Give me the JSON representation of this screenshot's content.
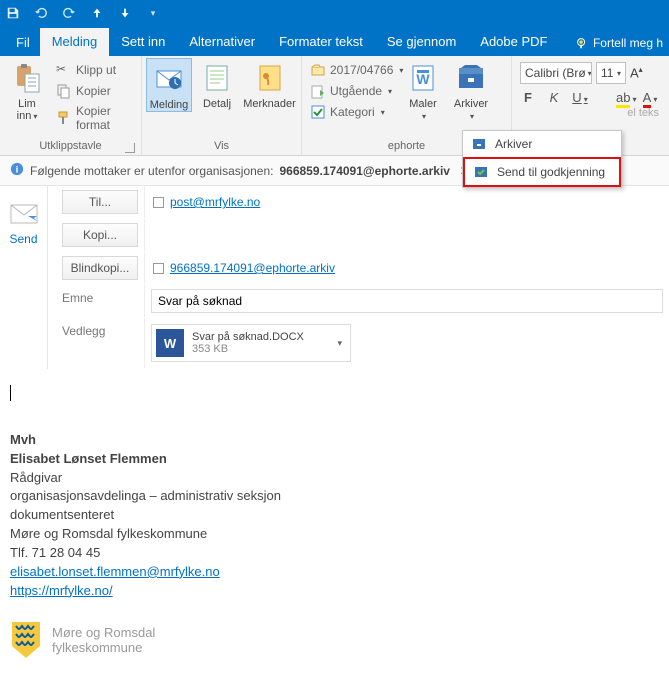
{
  "tabs": {
    "file": "Fil",
    "message": "Melding",
    "insert": "Sett inn",
    "options": "Alternativer",
    "format": "Formater tekst",
    "review": "Se gjennom",
    "adobe": "Adobe PDF",
    "tellme": "Fortell meg h"
  },
  "clipboard": {
    "paste": "Lim\ninn",
    "cut": "Klipp ut",
    "copy": "Kopier",
    "painter": "Kopier format",
    "group": "Utklippstavle"
  },
  "vis": {
    "message": "Melding",
    "detail": "Detalj",
    "notes": "Merknader",
    "group": "Vis"
  },
  "ephorte": {
    "case": "2017/04766",
    "outgoing": "Utgående",
    "category": "Kategori",
    "templates": "Maler",
    "archive": "Arkiver",
    "group": "ephorte"
  },
  "archive_menu": {
    "item1": "Arkiver",
    "item2": "Send til godkjenning"
  },
  "font": {
    "name": "Calibri (Brø",
    "size": "11",
    "bold": "F",
    "italic": "K",
    "underline": "U"
  },
  "warning": {
    "text": "Følgende mottaker er utenfor organisasjonen:",
    "email": "966859.174091@ephorte.arkiv"
  },
  "send": "Send",
  "fields": {
    "to_btn": "Til...",
    "to_val": "post@mrfylke.no",
    "cc_btn": "Kopi...",
    "bcc_btn": "Blindkopi...",
    "bcc_val": "966859.174091@ephorte.arkiv",
    "subject_lbl": "Emne",
    "subject_val": "Svar på søknad",
    "attach_lbl": "Vedlegg"
  },
  "attachment": {
    "name": "Svar på søknad.DOCX",
    "size": "353 KB"
  },
  "signature": {
    "regards": "Mvh",
    "name": "Elisabet Lønset Flemmen",
    "title": "Rådgivar",
    "dept": "organisasjonsavdelinga – administrativ seksjon",
    "unit": "dokumentsenteret",
    "org": "Møre og Romsdal fylkeskommune",
    "phone": "Tlf. 71 28 04 45",
    "email": "elisabet.lonset.flemmen@mrfylke.no",
    "url": "https://mrfylke.no/",
    "brand1": "Møre og Romsdal",
    "brand2": "fylkeskommune"
  }
}
